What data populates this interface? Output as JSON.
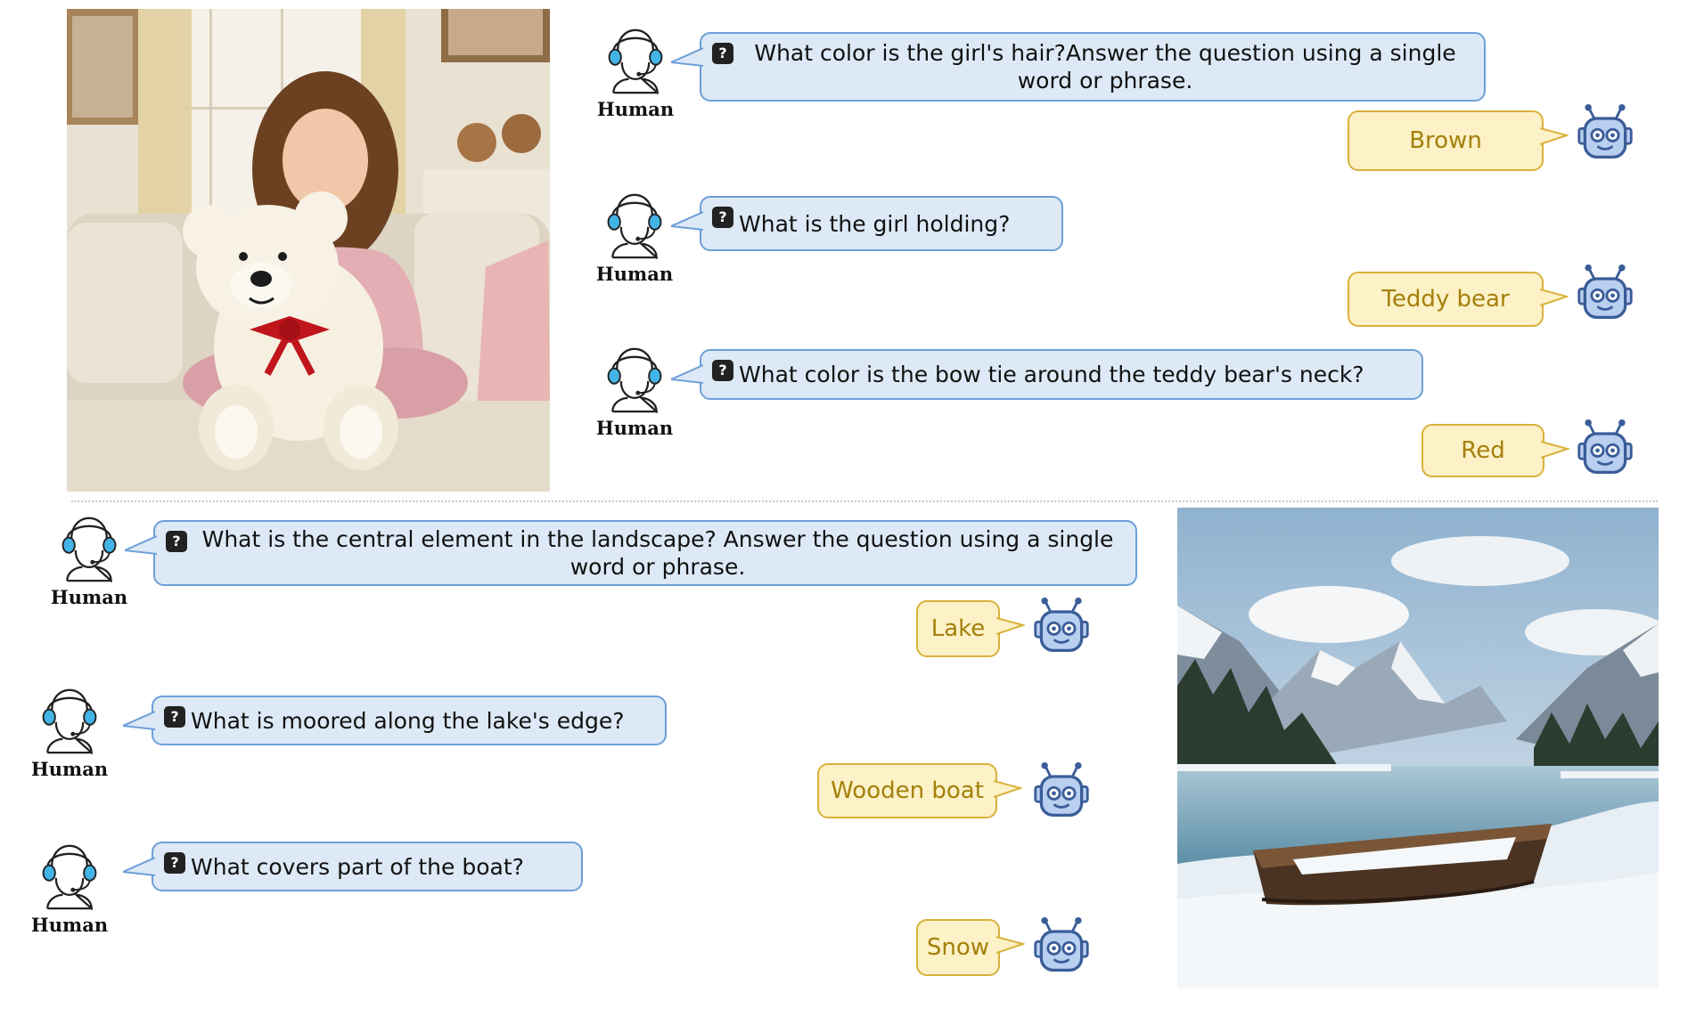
{
  "colors": {
    "question_fill": "#dde9f6",
    "question_border": "#6d9fd8",
    "answer_fill": "#fdf1c7",
    "answer_border": "#d8b23a",
    "answer_text": "#a3800b",
    "bot_fill": "#b9cff0",
    "bot_stroke": "#3a5d98",
    "headset_accent": "#42b4e6"
  },
  "icons": {
    "human": "human-headset-icon",
    "bot": "robot-icon",
    "question": "question-mark-icon"
  },
  "qmark_glyph": "?",
  "panels": [
    {
      "image_subject": "girl-with-teddy-bear-photo",
      "turns": [
        {
          "speaker": "Human",
          "question": "What color is the girl's hair?Answer the question using a single word or phrase.",
          "answer": "Brown"
        },
        {
          "speaker": "Human",
          "question": "What is the girl holding?",
          "answer": "Teddy bear"
        },
        {
          "speaker": "Human",
          "question": "What color is the bow tie around the teddy bear's neck?",
          "answer": "Red"
        }
      ]
    },
    {
      "image_subject": "mountain-lake-boat-photo",
      "turns": [
        {
          "speaker": "Human",
          "question": "What is the central element in the landscape? Answer the question using a single word or phrase.",
          "answer": "Lake"
        },
        {
          "speaker": "Human",
          "question": "What is moored along the lake's edge?",
          "answer": "Wooden boat"
        },
        {
          "speaker": "Human",
          "question": "What covers part of the boat?",
          "answer": "Snow"
        }
      ]
    }
  ]
}
